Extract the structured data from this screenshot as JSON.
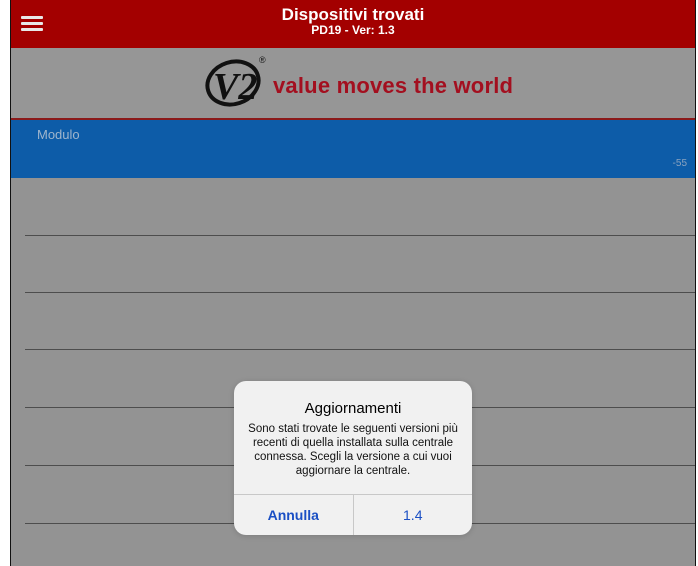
{
  "header": {
    "title": "Dispositivi trovati",
    "subtitle": "PD19 - Ver: 1.3",
    "menu_icon": "hamburger-menu-icon",
    "background_color": "#a30000"
  },
  "logo": {
    "mark_text": "V2",
    "registered": "®",
    "tagline": "value moves the world",
    "brand_color": "#a30f1f"
  },
  "devices": [
    {
      "name": "Modulo",
      "rssi": "-55"
    }
  ],
  "list": {
    "empty_rows": 6
  },
  "dialog": {
    "title": "Aggiornamenti",
    "message": "Sono stati trovate le seguenti versioni più recenti di quella installata sulla centrale connessa. Scegli la versione a cui vuoi aggiornare la centrale.",
    "buttons": {
      "cancel": "Annulla",
      "version": "1.4"
    },
    "button_color": "#1a4fc4"
  }
}
